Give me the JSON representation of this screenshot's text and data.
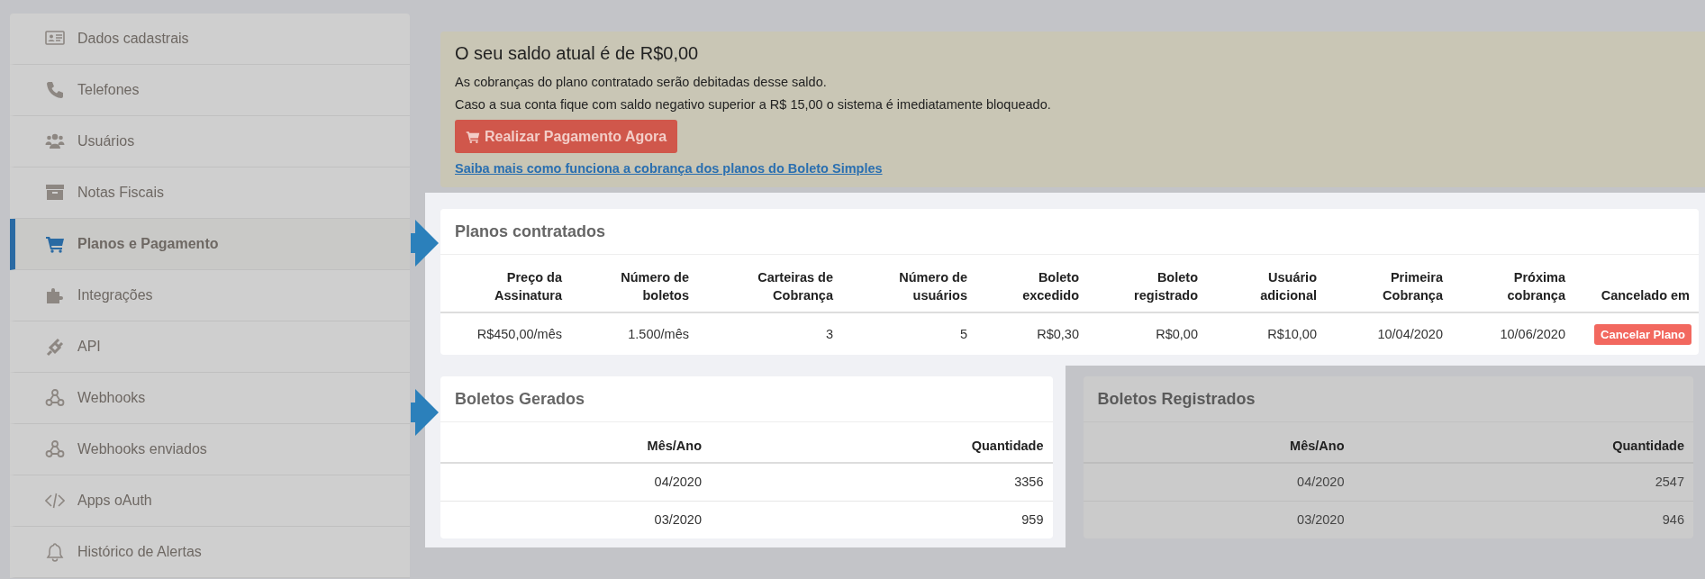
{
  "sidebar": {
    "items": [
      {
        "label": "Dados cadastrais",
        "selected": false
      },
      {
        "label": "Telefones",
        "selected": false
      },
      {
        "label": "Usuários",
        "selected": false
      },
      {
        "label": "Notas Fiscais",
        "selected": false
      },
      {
        "label": "Planos e Pagamento",
        "selected": true
      },
      {
        "label": "Integrações",
        "selected": false
      },
      {
        "label": "API",
        "selected": false
      },
      {
        "label": "Webhooks",
        "selected": false
      },
      {
        "label": "Webhooks enviados",
        "selected": false
      },
      {
        "label": "Apps oAuth",
        "selected": false
      },
      {
        "label": "Histórico de Alertas",
        "selected": false
      }
    ]
  },
  "balance": {
    "highlighted": false,
    "title": "O seu saldo atual é de R$0,00",
    "lines": [
      "As cobranças do plano contratado serão debitadas desse saldo.",
      "Caso a sua conta fique com saldo negativo superior a R$ 15,00 o sistema é imediatamente bloqueado."
    ],
    "pay_button": "Realizar Pagamento Agora",
    "link": "Saiba mais como funciona a cobrança dos planos do Boleto Simples"
  },
  "plans": {
    "highlighted": true,
    "title": "Planos contratados",
    "columns": [
      "Preço da Assinatura",
      "Número de boletos",
      "Carteiras de Cobrança",
      "Número de usuários",
      "Boleto excedido",
      "Boleto registrado",
      "Usuário adicional",
      "Primeira Cobrança",
      "Próxima cobrança",
      "Cancelado em"
    ],
    "rows": [
      {
        "cells": [
          "R$450,00/mês",
          "1.500/mês",
          "3",
          "5",
          "R$0,30",
          "R$0,00",
          "R$10,00",
          "10/04/2020",
          "10/06/2020"
        ],
        "cancel_button": "Cancelar Plano"
      }
    ]
  },
  "boletos_gerados": {
    "highlighted": true,
    "title": "Boletos Gerados",
    "columns": [
      "Mês/Ano",
      "Quantidade"
    ],
    "rows": [
      {
        "cells": [
          "04/2020",
          "3356"
        ]
      },
      {
        "cells": [
          "03/2020",
          "959"
        ]
      }
    ]
  },
  "boletos_registrados": {
    "highlighted": false,
    "title": "Boletos Registrados",
    "columns": [
      "Mês/Ano",
      "Quantidade"
    ],
    "rows": [
      {
        "cells": [
          "04/2020",
          "2547"
        ]
      },
      {
        "cells": [
          "03/2020",
          "946"
        ]
      }
    ]
  }
}
